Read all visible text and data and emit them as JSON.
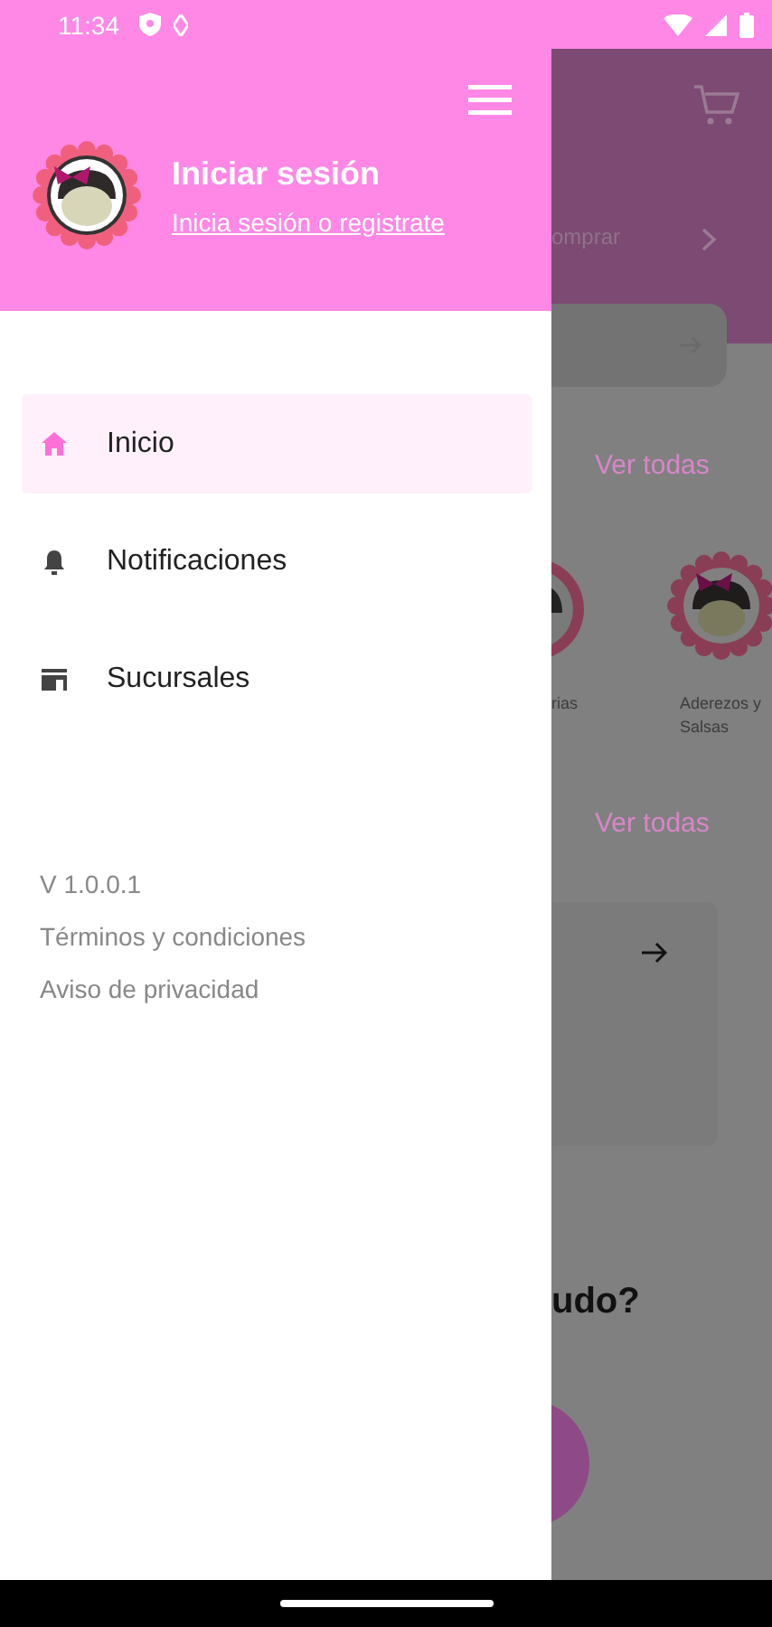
{
  "status_bar": {
    "time": "11:34"
  },
  "drawer": {
    "header": {
      "title": "Iniciar sesión",
      "link": "Inicia sesión o registrate"
    },
    "items": [
      {
        "label": "Inicio",
        "kind": "home",
        "selected": true
      },
      {
        "label": "Notificaciones",
        "kind": "bell",
        "selected": false
      },
      {
        "label": "Sucursales",
        "kind": "store",
        "selected": false
      }
    ],
    "version": "V 1.0.0.1",
    "links": [
      "Términos y condiciones",
      "Aviso de privacidad"
    ]
  },
  "background": {
    "banner_text": "omprar",
    "section_links": [
      "Ver todas",
      "Ver todas"
    ],
    "categories": [
      "rias",
      "Aderezos y Salsas"
    ],
    "heading": "udo?"
  }
}
